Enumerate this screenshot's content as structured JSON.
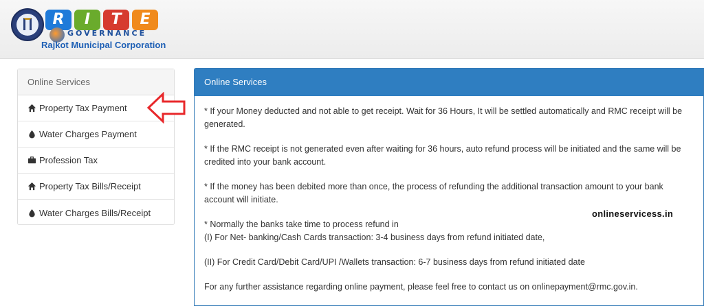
{
  "header": {
    "logo_letters": [
      "R",
      "I",
      "T",
      "E"
    ],
    "logo_subtitle": "GOVERNANCE",
    "organization": "Rajkot Municipal Corporation"
  },
  "sidebar": {
    "title": "Online Services",
    "items": [
      {
        "label": "Property Tax Payment",
        "icon": "home-icon"
      },
      {
        "label": "Water Charges Payment",
        "icon": "water-drop-icon"
      },
      {
        "label": "Profession Tax",
        "icon": "briefcase-icon"
      },
      {
        "label": "Property Tax Bills/Receipt",
        "icon": "home-icon"
      },
      {
        "label": "Water Charges Bills/Receipt",
        "icon": "water-drop-icon"
      }
    ]
  },
  "panel": {
    "title": "Online Services",
    "paragraphs": [
      "* If your Money deducted and not able to get receipt. Wait for 36 Hours, It will be settled automatically and RMC receipt will be generated.",
      "* If the RMC receipt is not generated even after waiting for 36 hours, auto refund process will be initiated and the same will be credited into your bank account.",
      "* If the money has been debited more than once, the process of refunding the additional transaction amount to your bank account will initiate.",
      "* Normally the banks take time to process refund in",
      "(I) For Net- banking/Cash Cards transaction: 3-4 business days from refund initiated date,",
      "(II) For Credit Card/Debit Card/UPI /Wallets transaction: 6-7 business days from refund initiated date",
      "For any further assistance regarding online payment, please feel free to contact us on onlinepayment@rmc.gov.in."
    ]
  },
  "watermark": "onlineservicess.in",
  "colors": {
    "panel_header": "#2f7ec1",
    "annotation_arrow": "#e8282b"
  }
}
